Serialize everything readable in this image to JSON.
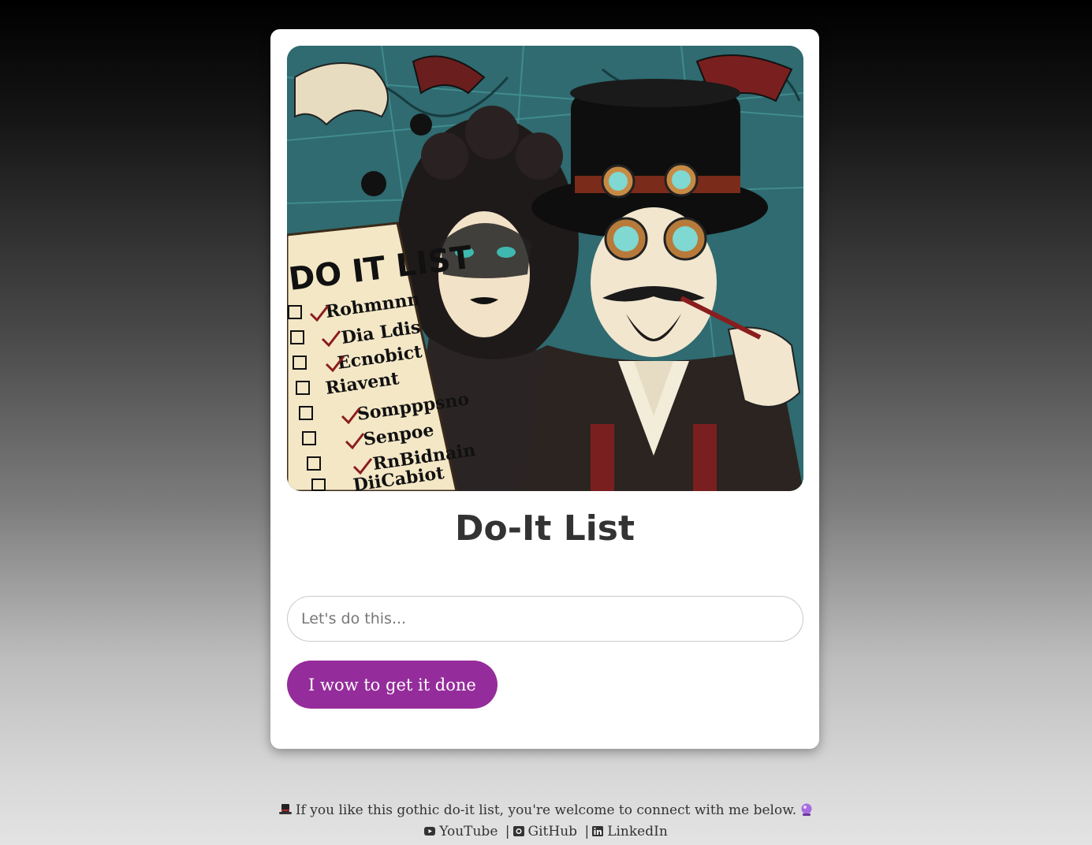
{
  "app": {
    "title": "Do-It List"
  },
  "hero": {
    "image_alt": "Gothic steampunk illustration: a masked woman and a top-hatted man with goggles beside a checklist",
    "list_heading": "DO IT LIST",
    "list_items": [
      "Rohmnnn",
      "Dia Ldis",
      "Ecnobict",
      "Riavent",
      "Sompppsno",
      "Senpoe",
      "RnBidnain",
      "DiiCabiot"
    ]
  },
  "form": {
    "input_placeholder": "Let's do this...",
    "input_value": "",
    "submit_label": "I wow to get it done"
  },
  "footer": {
    "message": "If you like this gothic do-it list, you're welcome to connect with me below.",
    "hat_icon": "top-hat-icon",
    "crystal_icon": "crystal-ball-icon",
    "links": [
      {
        "label": "YouTube",
        "icon": "youtube-icon"
      },
      {
        "label": "GitHub",
        "icon": "github-icon"
      },
      {
        "label": "LinkedIn",
        "icon": "linkedin-icon"
      }
    ],
    "separator": "|"
  },
  "colors": {
    "accent": "#952c9b",
    "card": "#ffffff",
    "text": "#333333"
  }
}
